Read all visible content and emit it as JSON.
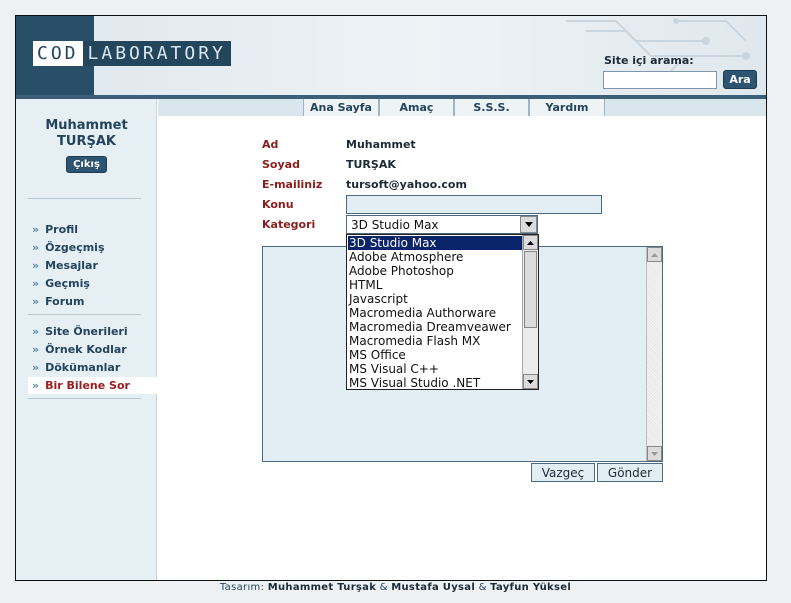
{
  "header": {
    "logo_left": "COD",
    "logo_right": "LABORATORY",
    "search_label": "Site içi arama:",
    "search_value": "",
    "search_button": "Ara"
  },
  "user": {
    "name_line1": "Muhammet",
    "name_line2": "TURŞAK",
    "logout_label": "Çıkış"
  },
  "sidebar": {
    "group1": [
      "Profil",
      "Özgeçmiş",
      "Mesajlar",
      "Geçmiş",
      "Forum"
    ],
    "group2": [
      "Site Önerileri",
      "Örnek Kodlar",
      "Dökümanlar",
      "Bir Bilene Sor"
    ],
    "active": "Bir Bilene Sor"
  },
  "nav": [
    "Ana Sayfa",
    "Amaç",
    "S.S.S.",
    "Yardım"
  ],
  "form": {
    "ad_label": "Ad",
    "ad_value": "Muhammet",
    "soyad_label": "Soyad",
    "soyad_value": "TURŞAK",
    "email_label": "E-mailiniz",
    "email_value": "tursoft@yahoo.com",
    "konu_label": "Konu",
    "konu_value": "",
    "kategori_label": "Kategori",
    "kategori_selected": "3D Studio Max",
    "message_value": "",
    "cancel_label": "Vazgeç",
    "submit_label": "Gönder"
  },
  "dropdown_options": [
    "3D Studio Max",
    "Adobe Atmosphere",
    "Adobe Photoshop",
    "HTML",
    "Javascript",
    "Macromedia Authorware",
    "Macromedia Dreamveawer",
    "Macromedia Flash MX",
    "MS Office",
    "MS Visual C++",
    "MS Visual Studio .NET"
  ],
  "footer": {
    "prefix": "Tasarım:",
    "name1": "Muhammet Turşak",
    "amp1": "&",
    "name2": "Mustafa Uysal",
    "amp2": "&",
    "name3": "Tayfun Yüksel"
  },
  "colors": {
    "primary": "#2d5572",
    "label_red": "#8a1e1e",
    "panel": "#e3eef4",
    "selection": "#0a246a"
  }
}
